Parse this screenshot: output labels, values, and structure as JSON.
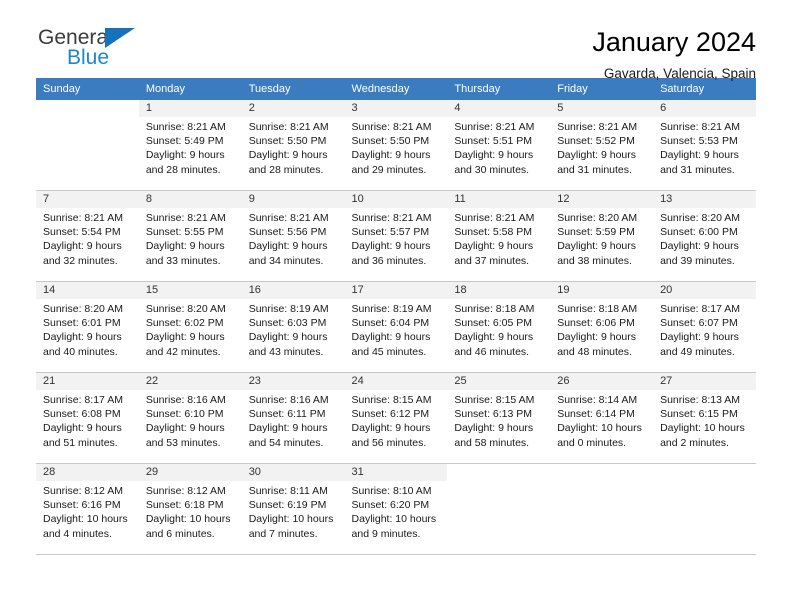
{
  "brand": {
    "line1": "General",
    "line2": "Blue",
    "triangle_color": "#1572bb",
    "line2_color": "#1f85d0"
  },
  "header": {
    "title": "January 2024",
    "location": "Gavarda, Valencia, Spain"
  },
  "theme": {
    "header_row_bg": "#3b7cc0",
    "daynum_band_bg": "#f2f2f2",
    "grid_line": "#c8c8c8"
  },
  "weekday_headers": [
    "Sunday",
    "Monday",
    "Tuesday",
    "Wednesday",
    "Thursday",
    "Friday",
    "Saturday"
  ],
  "labels": {
    "sunrise_prefix": "Sunrise:",
    "sunset_prefix": "Sunset:",
    "daylight_prefix": "Daylight:"
  },
  "weeks": [
    [
      {
        "day": "",
        "blank": true,
        "sunrise": "",
        "sunset": "",
        "daylight_line1": "",
        "daylight_line2": ""
      },
      {
        "day": "1",
        "sunrise": "Sunrise: 8:21 AM",
        "sunset": "Sunset: 5:49 PM",
        "daylight_line1": "Daylight: 9 hours",
        "daylight_line2": "and 28 minutes."
      },
      {
        "day": "2",
        "sunrise": "Sunrise: 8:21 AM",
        "sunset": "Sunset: 5:50 PM",
        "daylight_line1": "Daylight: 9 hours",
        "daylight_line2": "and 28 minutes."
      },
      {
        "day": "3",
        "sunrise": "Sunrise: 8:21 AM",
        "sunset": "Sunset: 5:50 PM",
        "daylight_line1": "Daylight: 9 hours",
        "daylight_line2": "and 29 minutes."
      },
      {
        "day": "4",
        "sunrise": "Sunrise: 8:21 AM",
        "sunset": "Sunset: 5:51 PM",
        "daylight_line1": "Daylight: 9 hours",
        "daylight_line2": "and 30 minutes."
      },
      {
        "day": "5",
        "sunrise": "Sunrise: 8:21 AM",
        "sunset": "Sunset: 5:52 PM",
        "daylight_line1": "Daylight: 9 hours",
        "daylight_line2": "and 31 minutes."
      },
      {
        "day": "6",
        "sunrise": "Sunrise: 8:21 AM",
        "sunset": "Sunset: 5:53 PM",
        "daylight_line1": "Daylight: 9 hours",
        "daylight_line2": "and 31 minutes."
      }
    ],
    [
      {
        "day": "7",
        "sunrise": "Sunrise: 8:21 AM",
        "sunset": "Sunset: 5:54 PM",
        "daylight_line1": "Daylight: 9 hours",
        "daylight_line2": "and 32 minutes."
      },
      {
        "day": "8",
        "sunrise": "Sunrise: 8:21 AM",
        "sunset": "Sunset: 5:55 PM",
        "daylight_line1": "Daylight: 9 hours",
        "daylight_line2": "and 33 minutes."
      },
      {
        "day": "9",
        "sunrise": "Sunrise: 8:21 AM",
        "sunset": "Sunset: 5:56 PM",
        "daylight_line1": "Daylight: 9 hours",
        "daylight_line2": "and 34 minutes."
      },
      {
        "day": "10",
        "sunrise": "Sunrise: 8:21 AM",
        "sunset": "Sunset: 5:57 PM",
        "daylight_line1": "Daylight: 9 hours",
        "daylight_line2": "and 36 minutes."
      },
      {
        "day": "11",
        "sunrise": "Sunrise: 8:21 AM",
        "sunset": "Sunset: 5:58 PM",
        "daylight_line1": "Daylight: 9 hours",
        "daylight_line2": "and 37 minutes."
      },
      {
        "day": "12",
        "sunrise": "Sunrise: 8:20 AM",
        "sunset": "Sunset: 5:59 PM",
        "daylight_line1": "Daylight: 9 hours",
        "daylight_line2": "and 38 minutes."
      },
      {
        "day": "13",
        "sunrise": "Sunrise: 8:20 AM",
        "sunset": "Sunset: 6:00 PM",
        "daylight_line1": "Daylight: 9 hours",
        "daylight_line2": "and 39 minutes."
      }
    ],
    [
      {
        "day": "14",
        "sunrise": "Sunrise: 8:20 AM",
        "sunset": "Sunset: 6:01 PM",
        "daylight_line1": "Daylight: 9 hours",
        "daylight_line2": "and 40 minutes."
      },
      {
        "day": "15",
        "sunrise": "Sunrise: 8:20 AM",
        "sunset": "Sunset: 6:02 PM",
        "daylight_line1": "Daylight: 9 hours",
        "daylight_line2": "and 42 minutes."
      },
      {
        "day": "16",
        "sunrise": "Sunrise: 8:19 AM",
        "sunset": "Sunset: 6:03 PM",
        "daylight_line1": "Daylight: 9 hours",
        "daylight_line2": "and 43 minutes."
      },
      {
        "day": "17",
        "sunrise": "Sunrise: 8:19 AM",
        "sunset": "Sunset: 6:04 PM",
        "daylight_line1": "Daylight: 9 hours",
        "daylight_line2": "and 45 minutes."
      },
      {
        "day": "18",
        "sunrise": "Sunrise: 8:18 AM",
        "sunset": "Sunset: 6:05 PM",
        "daylight_line1": "Daylight: 9 hours",
        "daylight_line2": "and 46 minutes."
      },
      {
        "day": "19",
        "sunrise": "Sunrise: 8:18 AM",
        "sunset": "Sunset: 6:06 PM",
        "daylight_line1": "Daylight: 9 hours",
        "daylight_line2": "and 48 minutes."
      },
      {
        "day": "20",
        "sunrise": "Sunrise: 8:17 AM",
        "sunset": "Sunset: 6:07 PM",
        "daylight_line1": "Daylight: 9 hours",
        "daylight_line2": "and 49 minutes."
      }
    ],
    [
      {
        "day": "21",
        "sunrise": "Sunrise: 8:17 AM",
        "sunset": "Sunset: 6:08 PM",
        "daylight_line1": "Daylight: 9 hours",
        "daylight_line2": "and 51 minutes."
      },
      {
        "day": "22",
        "sunrise": "Sunrise: 8:16 AM",
        "sunset": "Sunset: 6:10 PM",
        "daylight_line1": "Daylight: 9 hours",
        "daylight_line2": "and 53 minutes."
      },
      {
        "day": "23",
        "sunrise": "Sunrise: 8:16 AM",
        "sunset": "Sunset: 6:11 PM",
        "daylight_line1": "Daylight: 9 hours",
        "daylight_line2": "and 54 minutes."
      },
      {
        "day": "24",
        "sunrise": "Sunrise: 8:15 AM",
        "sunset": "Sunset: 6:12 PM",
        "daylight_line1": "Daylight: 9 hours",
        "daylight_line2": "and 56 minutes."
      },
      {
        "day": "25",
        "sunrise": "Sunrise: 8:15 AM",
        "sunset": "Sunset: 6:13 PM",
        "daylight_line1": "Daylight: 9 hours",
        "daylight_line2": "and 58 minutes."
      },
      {
        "day": "26",
        "sunrise": "Sunrise: 8:14 AM",
        "sunset": "Sunset: 6:14 PM",
        "daylight_line1": "Daylight: 10 hours",
        "daylight_line2": "and 0 minutes."
      },
      {
        "day": "27",
        "sunrise": "Sunrise: 8:13 AM",
        "sunset": "Sunset: 6:15 PM",
        "daylight_line1": "Daylight: 10 hours",
        "daylight_line2": "and 2 minutes."
      }
    ],
    [
      {
        "day": "28",
        "sunrise": "Sunrise: 8:12 AM",
        "sunset": "Sunset: 6:16 PM",
        "daylight_line1": "Daylight: 10 hours",
        "daylight_line2": "and 4 minutes."
      },
      {
        "day": "29",
        "sunrise": "Sunrise: 8:12 AM",
        "sunset": "Sunset: 6:18 PM",
        "daylight_line1": "Daylight: 10 hours",
        "daylight_line2": "and 6 minutes."
      },
      {
        "day": "30",
        "sunrise": "Sunrise: 8:11 AM",
        "sunset": "Sunset: 6:19 PM",
        "daylight_line1": "Daylight: 10 hours",
        "daylight_line2": "and 7 minutes."
      },
      {
        "day": "31",
        "sunrise": "Sunrise: 8:10 AM",
        "sunset": "Sunset: 6:20 PM",
        "daylight_line1": "Daylight: 10 hours",
        "daylight_line2": "and 9 minutes."
      },
      {
        "day": "",
        "blank": true,
        "sunrise": "",
        "sunset": "",
        "daylight_line1": "",
        "daylight_line2": ""
      },
      {
        "day": "",
        "blank": true,
        "sunrise": "",
        "sunset": "",
        "daylight_line1": "",
        "daylight_line2": ""
      },
      {
        "day": "",
        "blank": true,
        "sunrise": "",
        "sunset": "",
        "daylight_line1": "",
        "daylight_line2": ""
      }
    ]
  ]
}
